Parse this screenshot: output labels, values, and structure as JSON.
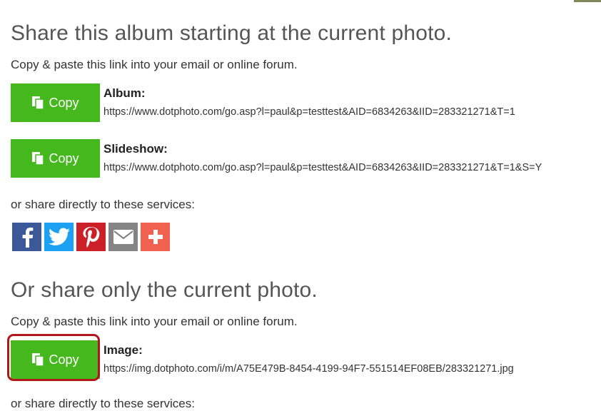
{
  "album_section": {
    "heading": "Share this album starting at the current photo.",
    "instruction": "Copy & paste this link into your email or online forum.",
    "rows": [
      {
        "button_label": "Copy",
        "label": "Album:",
        "url": "https://www.dotphoto.com/go.asp?l=paul&p=testtest&AID=6834263&IID=283321271&T=1"
      },
      {
        "button_label": "Copy",
        "label": "Slideshow:",
        "url": "https://www.dotphoto.com/go.asp?l=paul&p=testtest&AID=6834263&IID=283321271&T=1&S=Y"
      }
    ],
    "services_text": "or share directly to these services:",
    "services": [
      {
        "name": "facebook-icon",
        "color": "#3b5998"
      },
      {
        "name": "twitter-icon",
        "color": "#1da1f2"
      },
      {
        "name": "pinterest-icon",
        "color": "#cb2027"
      },
      {
        "name": "email-icon",
        "color": "#848484"
      },
      {
        "name": "plus-icon",
        "color": "#f0624f"
      }
    ]
  },
  "photo_section": {
    "heading": "Or share only the current photo.",
    "instruction": "Copy & paste this link into your email or online forum.",
    "rows": [
      {
        "button_label": "Copy",
        "label": "Image:",
        "url": "https://img.dotphoto.com/i/m/A75E479B-8454-4199-94F7-551514EF08EB/283321271.jpg"
      }
    ],
    "services_text_cut": "or share directly to these services:"
  },
  "colors": {
    "button": "#45b81e",
    "highlight": "#b0161c"
  }
}
